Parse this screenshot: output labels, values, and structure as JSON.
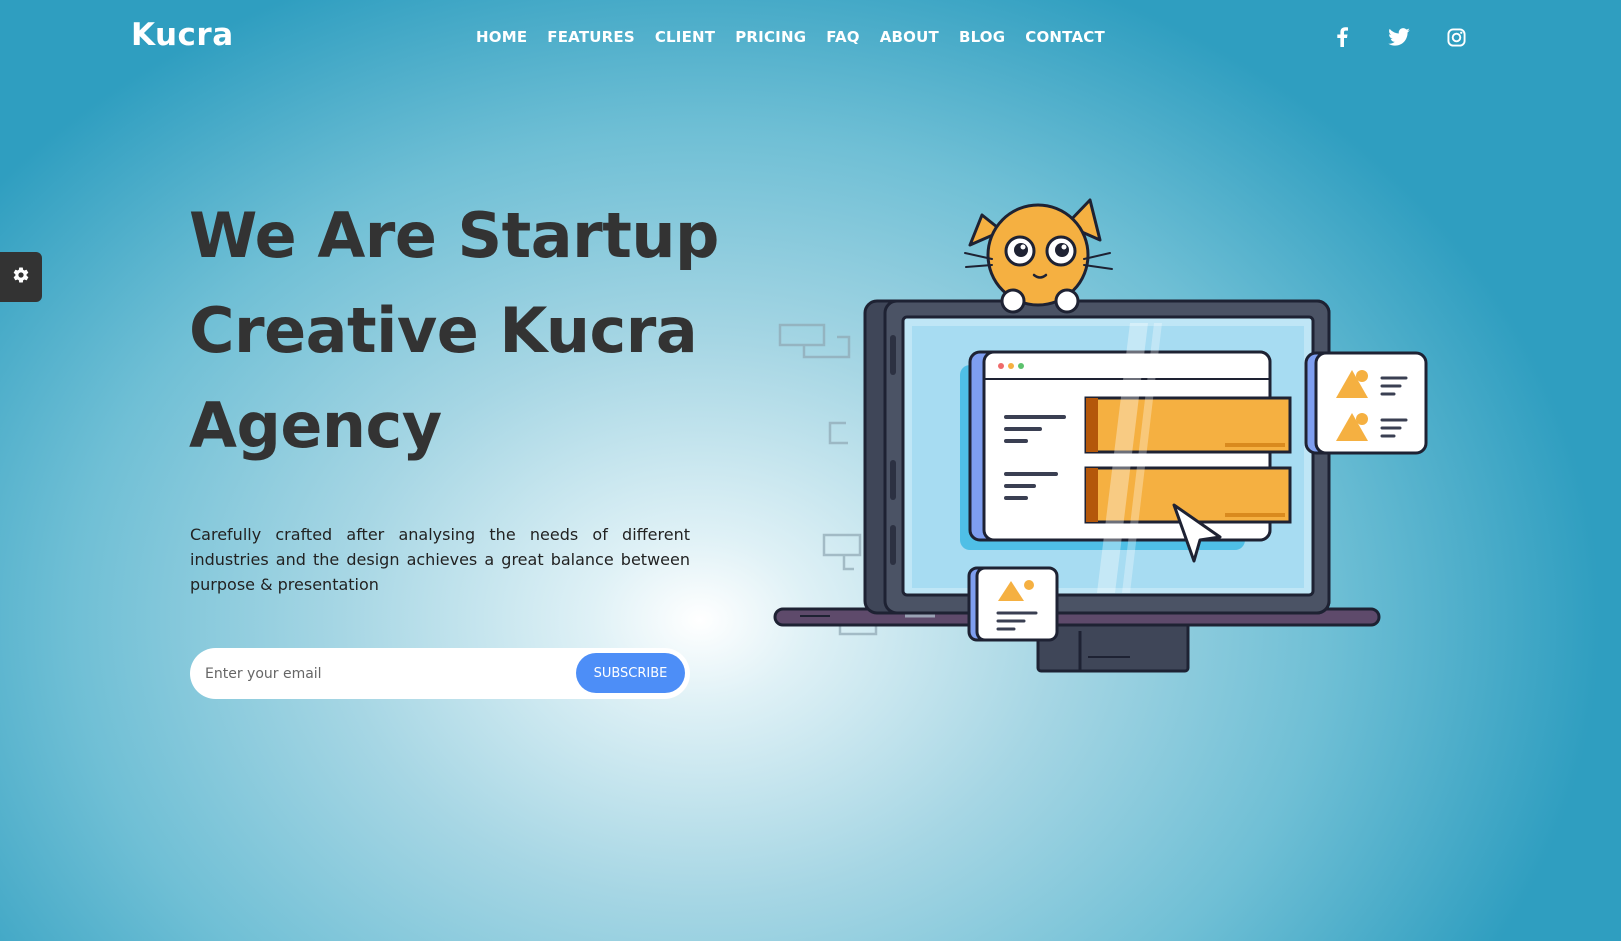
{
  "header": {
    "logo": "Kucra",
    "nav": [
      "HOME",
      "FEATURES",
      "CLIENT",
      "PRICING",
      "FAQ",
      "ABOUT",
      "BLOG",
      "CONTACT"
    ],
    "socials": [
      "facebook-icon",
      "twitter-icon",
      "instagram-icon"
    ]
  },
  "settings": {
    "icon": "gear-icon"
  },
  "hero": {
    "title_lines": [
      "We Are Startup",
      "Creative Kucra",
      "Agency"
    ],
    "description": "Carefully crafted after analysing the needs of different industries and the design achieves a great balance between purpose & presentation",
    "email_placeholder": "Enter your email",
    "subscribe_label": "SUBSCRIBE"
  },
  "colors": {
    "accent": "#4d8ef7",
    "text_dark": "#333333",
    "background_blue": "#2f9ec0",
    "illustration_orange": "#f5b041"
  }
}
